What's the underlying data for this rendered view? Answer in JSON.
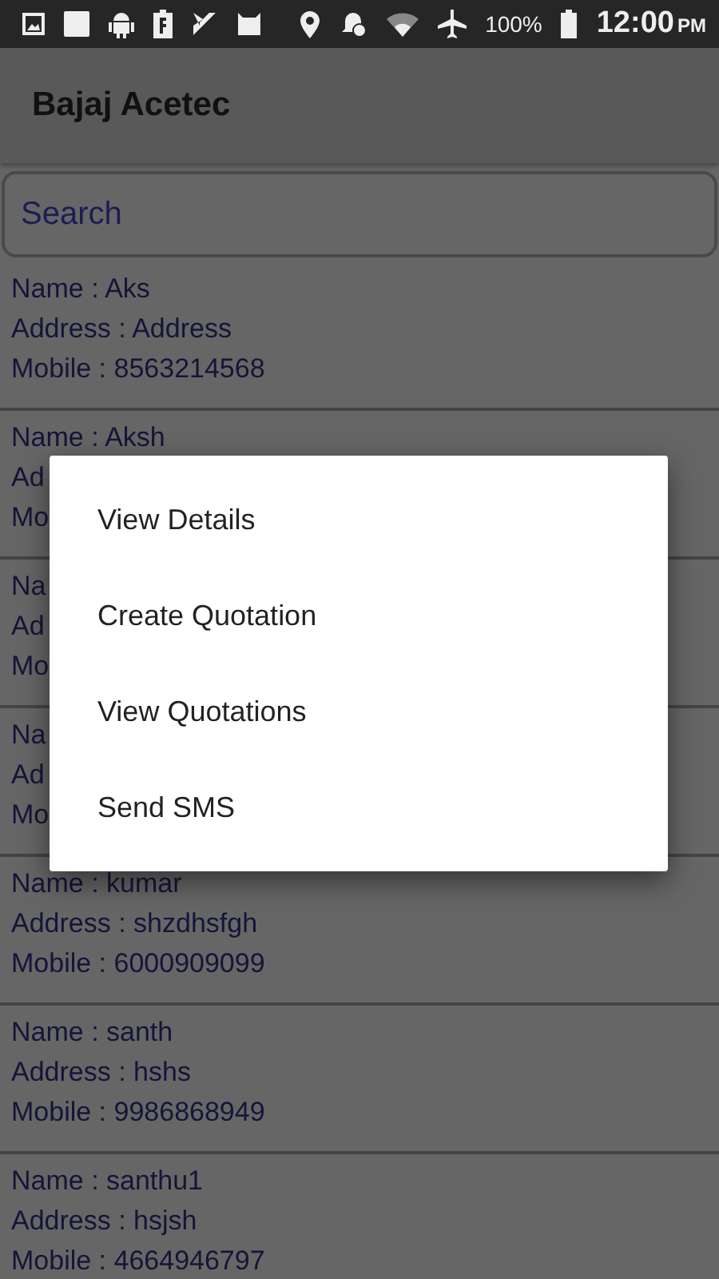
{
  "status_bar": {
    "battery": "100%",
    "time": "12:00",
    "ampm": "PM"
  },
  "app_bar": {
    "title": "Bajaj Acetec"
  },
  "search": {
    "placeholder": "Search"
  },
  "contacts": [
    {
      "name": "Name : Aks",
      "address": "Address : Address",
      "mobile": "Mobile : 8563214568"
    },
    {
      "name": "Name : Aksh",
      "address": "Ad",
      "mobile": "Mo"
    },
    {
      "name": "Na",
      "address": "Ad",
      "mobile": "Mo"
    },
    {
      "name": "Na",
      "address": "Ad",
      "mobile": "Mo"
    },
    {
      "name": "Name : kumar",
      "address": "Address : shzdhsfgh",
      "mobile": "Mobile : 6000909099"
    },
    {
      "name": "Name : santh",
      "address": "Address : hshs",
      "mobile": "Mobile : 9986868949"
    },
    {
      "name": "Name : santhu1",
      "address": "Address : hsjsh",
      "mobile": "Mobile : 4664946797"
    }
  ],
  "context_menu": {
    "items": [
      "View Details",
      "Create Quotation",
      "View Quotations",
      "Send SMS"
    ]
  }
}
